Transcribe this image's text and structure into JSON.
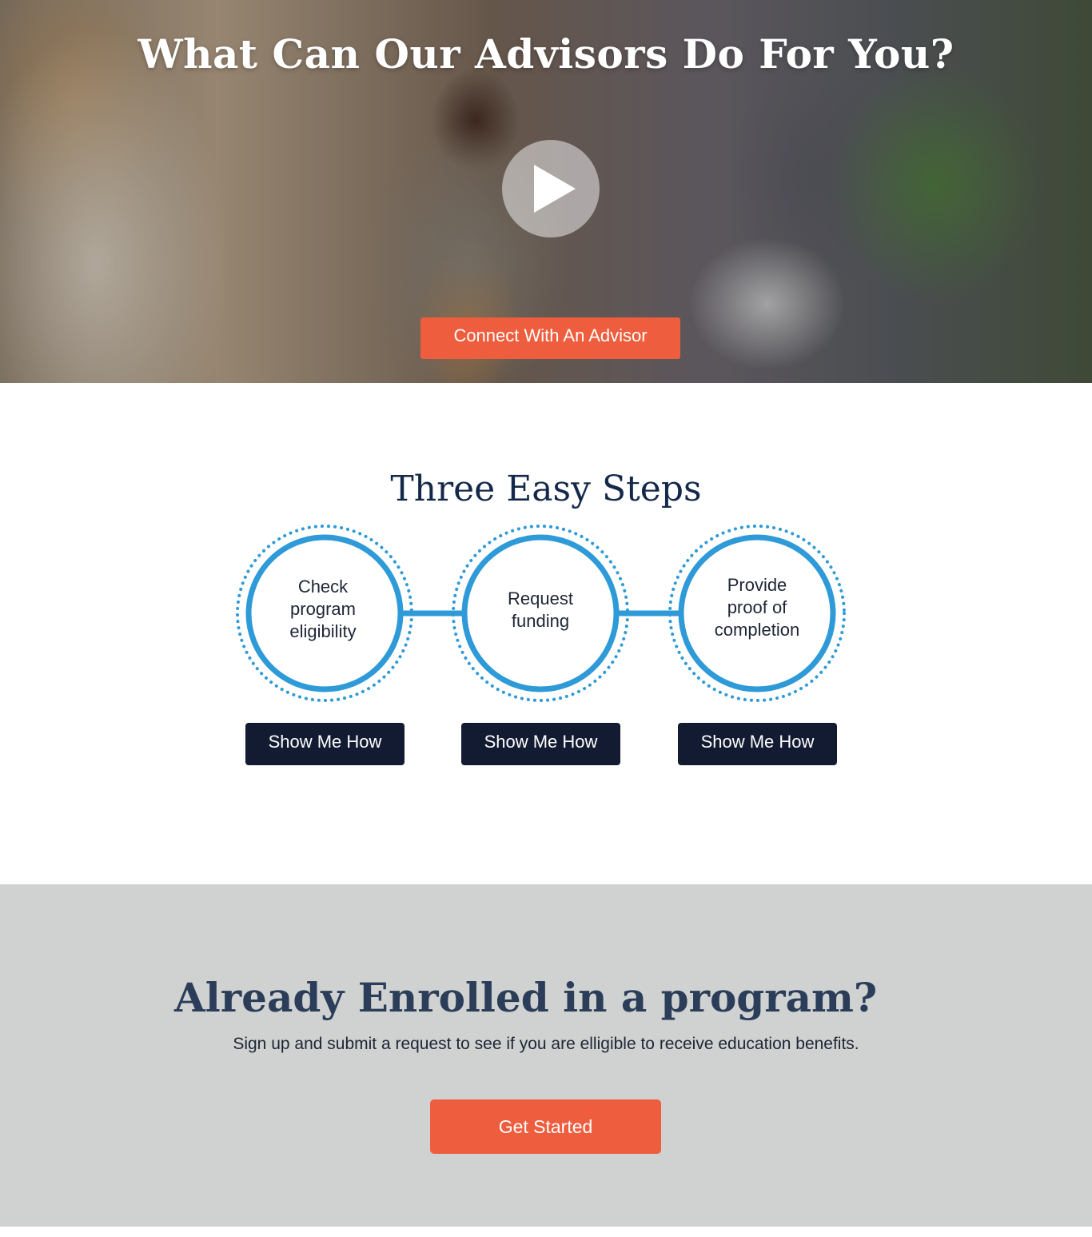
{
  "hero": {
    "title": "What Can Our Advisors Do For You?",
    "play_icon": "play-icon",
    "connect_label": "Connect With An Advisor"
  },
  "steps": {
    "title": "Three Easy Steps",
    "items": [
      {
        "label_lines": [
          "Check",
          "program",
          "eligibility"
        ],
        "button_label": "Show Me How"
      },
      {
        "label_lines": [
          "Request",
          "funding"
        ],
        "button_label": "Show Me How"
      },
      {
        "label_lines": [
          "Provide",
          "proof of",
          "completion"
        ],
        "button_label": "Show Me How"
      }
    ]
  },
  "enrolled": {
    "title": "Already Enrolled in a program?",
    "text": "Sign up and submit a request to see if you are elligible to receive education benefits.",
    "button_label": "Get Started"
  },
  "colors": {
    "accent": "#ee5d3d",
    "navy": "#121b31",
    "circle_blue": "#2e9ad8",
    "gray_band": "#cfd2d1"
  }
}
